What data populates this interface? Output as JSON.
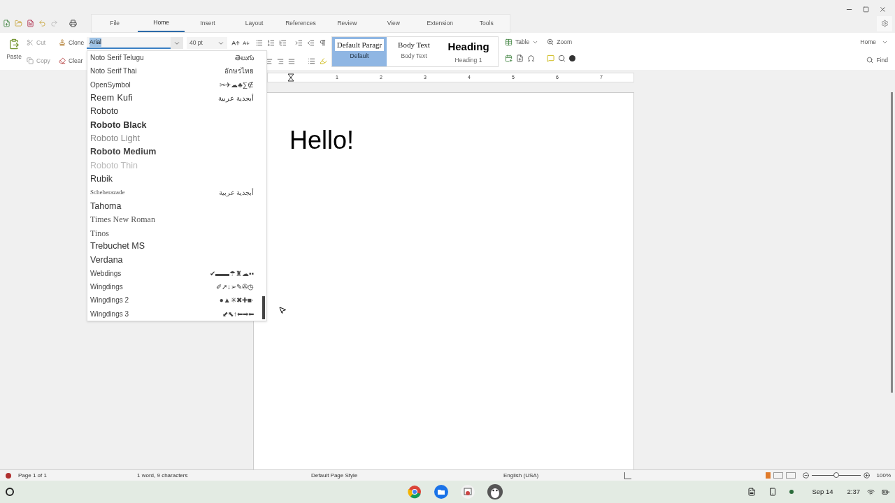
{
  "tabs": [
    {
      "label": "File",
      "selected": false
    },
    {
      "label": "Home",
      "selected": true
    },
    {
      "label": "Insert",
      "selected": false
    },
    {
      "label": "Layout",
      "selected": false
    },
    {
      "label": "References",
      "selected": false
    },
    {
      "label": "Review",
      "selected": false
    },
    {
      "label": "View",
      "selected": false
    },
    {
      "label": "Extension",
      "selected": false
    },
    {
      "label": "Tools",
      "selected": false
    }
  ],
  "ribbon": {
    "paste": "Paste",
    "cut": "Cut",
    "copy": "Copy",
    "clone": "Clone",
    "clear": "Clear",
    "font_name": "Arial",
    "font_size": "40 pt",
    "styles": [
      {
        "preview": "Default Paragr",
        "caption": "Default",
        "selected": true,
        "kind": "serif"
      },
      {
        "preview": "Body Text",
        "caption": "Body Text",
        "selected": false,
        "kind": "serif"
      },
      {
        "preview": "Heading",
        "caption": "Heading 1",
        "selected": false,
        "kind": "heading"
      }
    ],
    "table": "Table",
    "zoom": "Zoom",
    "mode": "Home",
    "find": "Find"
  },
  "font_list": [
    {
      "name": "Noto Serif Telugu",
      "sample": "తెలుగు",
      "kind": "small"
    },
    {
      "name": "Noto Serif Thai",
      "sample": "อักษรไทย",
      "kind": "small"
    },
    {
      "name": "OpenSymbol",
      "sample": "✂✈☁♣∑∉",
      "kind": "small"
    },
    {
      "name": "Reem Kufi",
      "sample": "أبجدية عربية",
      "kind": "kufi"
    },
    {
      "name": "Roboto",
      "kind": "regular"
    },
    {
      "name": "Roboto Black",
      "kind": "black"
    },
    {
      "name": "Roboto Light",
      "kind": "light"
    },
    {
      "name": "Roboto Medium",
      "kind": "medium"
    },
    {
      "name": "Roboto Thin",
      "kind": "thin"
    },
    {
      "name": "Rubik",
      "kind": "regular"
    },
    {
      "name": "Scheherazade",
      "sample": "أبجدية عربية",
      "kind": "tiny_serif"
    },
    {
      "name": "Tahoma",
      "kind": "regular"
    },
    {
      "name": "Times New Roman",
      "kind": "serif"
    },
    {
      "name": "Tinos",
      "kind": "serif"
    },
    {
      "name": "Trebuchet MS",
      "kind": "regular"
    },
    {
      "name": "Verdana",
      "kind": "regular"
    },
    {
      "name": "Webdings",
      "sample": "✔▬▬☂♜☁▪▪",
      "kind": "small"
    },
    {
      "name": "Wingdings",
      "sample": "✐➚↓➢✎✇◷",
      "kind": "small"
    },
    {
      "name": "Wingdings 2",
      "sample": "●▲✳✖✚■·",
      "kind": "small"
    },
    {
      "name": "Wingdings 3",
      "sample": "⬋⬉↑⬅➡⬅",
      "kind": "small"
    }
  ],
  "ruler": {
    "labels": [
      "1",
      "2",
      "3",
      "4",
      "5",
      "6",
      "7"
    ]
  },
  "document": {
    "text": "Hello!"
  },
  "status_bar": {
    "page": "Page 1 of 1",
    "words": "1 word, 9 characters",
    "page_style": "Default Page Style",
    "language": "English (USA)",
    "zoom_slider": {
      "level": 0.5
    },
    "zoom": "100%"
  },
  "shelf": {
    "date": "Sep 14",
    "time": "2:37"
  }
}
